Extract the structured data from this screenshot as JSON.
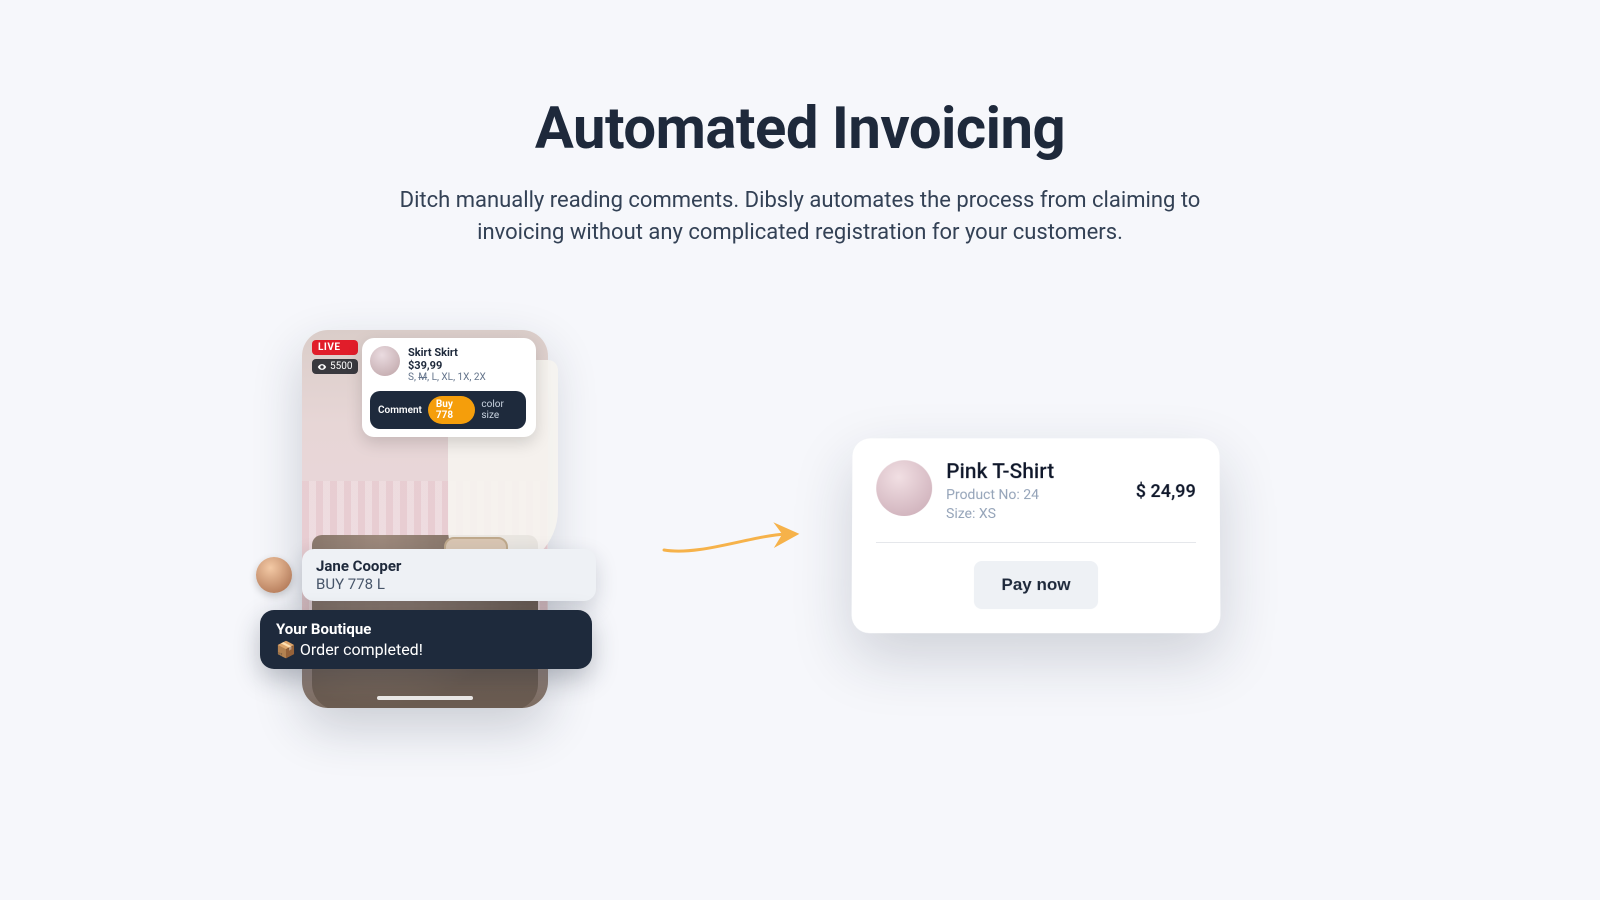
{
  "hero": {
    "title": "Automated Invoicing",
    "subtitle": "Ditch manually reading comments. Dibsly automates the process from claiming to invoicing without any complicated registration for your customers."
  },
  "stream": {
    "live_label": "LIVE",
    "viewers": "5500",
    "product": {
      "title": "Skirt Skirt",
      "price": "$39,99",
      "sizes_pre": "S, ",
      "sizes_strike": "M",
      "sizes_post": ", L, XL, 1X, 2X"
    },
    "buy_bar": {
      "comment_label": "Comment",
      "buy_pill": "Buy 778",
      "hint": "color size"
    },
    "comment": {
      "name": "Jane Cooper",
      "message": "BUY 778 L"
    },
    "reply": {
      "name": "Your Boutique",
      "message": "📦 Order completed!"
    }
  },
  "invoice": {
    "title": "Pink T-Shirt",
    "product_no_label": "Product No: 24",
    "size_label": "Size: XS",
    "price": "$ 24,99",
    "pay_label": "Pay now"
  }
}
